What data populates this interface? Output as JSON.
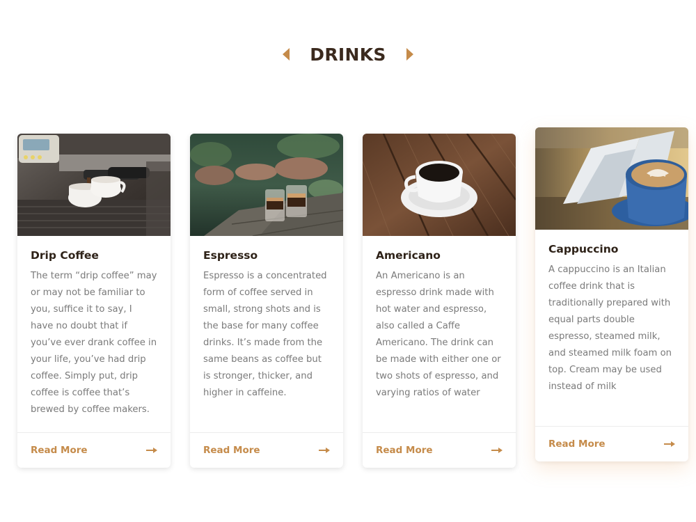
{
  "section": {
    "title": "DRINKS"
  },
  "colors": {
    "accent": "#c58b4a",
    "title": "#3b2a1e",
    "body_text": "#7a7a7a"
  },
  "cards": [
    {
      "title": "Drip Coffee",
      "text": "The term “drip coffee” may or may not be familiar to you, suffice it to say, I have no doubt that if you’ve ever drank coffee in your life, you’ve had drip coffee. Simply put, drip coffee is coffee that’s brewed by coffee makers.",
      "link_label": "Read More",
      "image_icon": "espresso-machine-photo"
    },
    {
      "title": "Espresso",
      "text": "Espresso is a concentrated form of coffee served in small, strong shots and is the base for many coffee drinks. It’s made from the same beans as coffee but is stronger, thicker, and higher in caffeine.",
      "link_label": "Read More",
      "image_icon": "espresso-glasses-photo"
    },
    {
      "title": "Americano",
      "text": "An Americano is an espresso drink made with hot water and espresso, also called a Caffe Americano. The drink can be made with either one or two shots of espresso, and varying ratios of water",
      "link_label": "Read More",
      "image_icon": "coffee-cup-on-table-photo"
    },
    {
      "title": "Cappuccino",
      "text": "A cappuccino is an Italian coffee drink that is traditionally prepared with equal parts double espresso, steamed milk, and steamed milk foam on top. Cream may be used instead of milk",
      "link_label": "Read More",
      "image_icon": "cappuccino-with-book-photo"
    }
  ]
}
